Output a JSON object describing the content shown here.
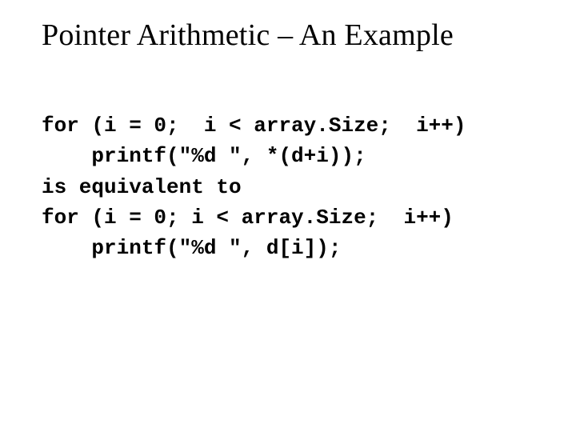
{
  "title": "Pointer Arithmetic – An Example",
  "code": {
    "l1": "for (i = 0;  i < array.Size;  i++)",
    "l2": "    printf(\"%d \", *(d+i));",
    "l3": "is equivalent to",
    "l4": "for (i = 0; i < array.Size;  i++)",
    "l5": "    printf(\"%d \", d[i]);"
  }
}
